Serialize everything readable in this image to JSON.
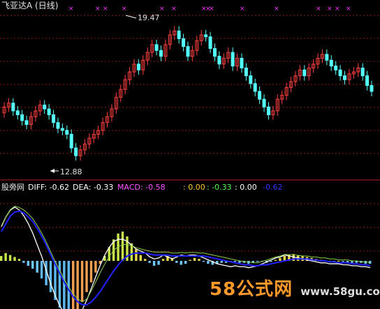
{
  "main_panel": {
    "title": "飞亚达A (日线)",
    "high_label": "19.47",
    "low_label": "12.88",
    "signal_marker": "×"
  },
  "indicator_panel": {
    "name": "股旁网",
    "diff": "DIFF: -0.62",
    "dea": "DEA: -0.33",
    "macd": "MACD: -0.58",
    "v1": ": 0.00",
    "v2": ": -0.33",
    "v3": ": 0.00",
    "v4": "-0.62"
  },
  "watermark": {
    "brand": "58公式网",
    "url": "www.58gu.com"
  },
  "colors": {
    "background": "#000000",
    "grid": "#8b1a1a",
    "up_candle": "#ff4040",
    "down_candle": "#54ffff",
    "diff_line": "#ffffff",
    "dea_line": "#2020ff",
    "macd_text": "#ff55ff",
    "signal": "#ff33ff"
  },
  "chart_data": {
    "type": "candlestick",
    "title": "飞亚达A (日线)",
    "high_marker": 19.47,
    "low_marker": 12.88,
    "ylim": [
      12.3,
      20.1
    ],
    "closes": [
      15.4,
      15.6,
      15.2,
      15.0,
      14.7,
      14.5,
      14.9,
      15.2,
      15.5,
      15.3,
      15.0,
      14.6,
      14.3,
      14.2,
      14.0,
      13.3,
      12.9,
      13.2,
      13.5,
      13.8,
      14.0,
      14.2,
      14.6,
      14.9,
      15.3,
      15.9,
      16.3,
      16.8,
      17.2,
      17.6,
      17.3,
      17.8,
      18.2,
      18.6,
      18.3,
      18.0,
      18.6,
      19.1,
      19.3,
      18.9,
      18.5,
      18.0,
      18.3,
      18.8,
      19.1,
      19.0,
      18.4,
      18.0,
      17.6,
      17.9,
      18.2,
      17.5,
      17.9,
      17.4,
      17.0,
      16.6,
      16.2,
      15.8,
      15.4,
      15.0,
      15.2,
      15.8,
      16.0,
      16.4,
      16.7,
      17.0,
      17.3,
      17.0,
      17.4,
      17.6,
      17.9,
      18.1,
      17.8,
      17.5,
      17.3,
      17.0,
      16.8,
      17.1,
      17.2,
      17.4,
      17.0,
      16.5,
      16.2
    ],
    "opens": [
      15.1,
      15.4,
      15.6,
      15.2,
      15.0,
      14.7,
      14.5,
      14.9,
      15.2,
      15.5,
      15.3,
      15.0,
      14.6,
      14.3,
      14.2,
      14.0,
      13.3,
      12.9,
      13.2,
      13.5,
      13.8,
      14.0,
      14.2,
      14.6,
      14.9,
      15.3,
      15.9,
      16.3,
      16.8,
      17.2,
      17.6,
      17.3,
      17.8,
      18.2,
      18.6,
      18.3,
      18.0,
      18.6,
      19.1,
      19.3,
      18.9,
      18.5,
      18.0,
      18.3,
      18.8,
      19.1,
      19.0,
      18.4,
      18.0,
      17.6,
      17.9,
      18.2,
      17.5,
      17.9,
      17.4,
      17.0,
      16.6,
      16.2,
      15.8,
      15.4,
      15.0,
      15.2,
      15.8,
      16.0,
      16.4,
      16.7,
      17.0,
      17.3,
      17.0,
      17.4,
      17.6,
      17.9,
      18.1,
      17.8,
      17.5,
      17.3,
      17.0,
      16.8,
      17.1,
      17.2,
      17.4,
      17.0,
      16.5
    ],
    "macd_bars": [
      0.05,
      0.08,
      0.06,
      0.04,
      0.02,
      -0.02,
      -0.05,
      -0.08,
      -0.12,
      -0.18,
      -0.25,
      -0.32,
      -0.4,
      -0.48,
      -0.55,
      -0.62,
      -0.58,
      -0.5,
      -0.42,
      -0.32,
      -0.22,
      -0.12,
      -0.03,
      0.05,
      0.14,
      0.22,
      0.28,
      0.3,
      0.25,
      0.18,
      0.12,
      0.06,
      0.02,
      -0.02,
      -0.05,
      -0.04,
      0.02,
      0.05,
      0.03,
      -0.02,
      -0.04,
      -0.03,
      0.01,
      0.03,
      0.02,
      -0.01,
      -0.03,
      -0.04,
      -0.03,
      -0.02,
      -0.02,
      -0.01,
      -0.01,
      -0.02,
      -0.02,
      -0.03,
      -0.02,
      -0.01,
      -0.01,
      -0.02,
      -0.01,
      0.01,
      0.03,
      0.05,
      0.06,
      0.07,
      0.06,
      0.05,
      0.04,
      0.03,
      0.02,
      0.01,
      0.0,
      -0.01,
      -0.01,
      0.0,
      -0.01,
      -0.02,
      -0.02,
      -0.02,
      -0.02,
      -0.03,
      -0.03
    ],
    "diff_line": [
      0.35,
      0.45,
      0.52,
      0.55,
      0.52,
      0.46,
      0.38,
      0.28,
      0.16,
      0.04,
      -0.1,
      -0.24,
      -0.36,
      -0.46,
      -0.54,
      -0.6,
      -0.62,
      -0.58,
      -0.5,
      -0.4,
      -0.28,
      -0.16,
      -0.04,
      0.06,
      0.14,
      0.2,
      0.22,
      0.22,
      0.2,
      0.16,
      0.12,
      0.1,
      0.08,
      0.04,
      0.02,
      0.03,
      0.06,
      0.04,
      0.02,
      0.04,
      0.06,
      0.05,
      0.06,
      0.06,
      0.05,
      0.03,
      0.01,
      -0.01,
      -0.03,
      -0.04,
      -0.05,
      -0.06,
      -0.05,
      -0.06,
      -0.06,
      -0.07,
      -0.06,
      -0.05,
      -0.03,
      -0.01,
      0.01,
      0.03,
      0.04,
      0.06,
      0.05,
      0.04,
      0.03,
      0.02,
      0.01,
      0.0,
      -0.01,
      -0.02,
      -0.02,
      -0.03,
      -0.03,
      -0.03,
      -0.04,
      -0.04,
      -0.05,
      -0.05,
      -0.06,
      -0.06,
      -0.07
    ],
    "dea_line": [
      0.3,
      0.38,
      0.46,
      0.5,
      0.51,
      0.49,
      0.45,
      0.4,
      0.33,
      0.25,
      0.16,
      0.06,
      -0.04,
      -0.13,
      -0.22,
      -0.3,
      -0.37,
      -0.42,
      -0.45,
      -0.45,
      -0.42,
      -0.37,
      -0.31,
      -0.24,
      -0.17,
      -0.1,
      -0.04,
      0.01,
      0.05,
      0.07,
      0.08,
      0.08,
      0.08,
      0.07,
      0.06,
      0.06,
      0.06,
      0.06,
      0.05,
      0.05,
      0.05,
      0.05,
      0.05,
      0.05,
      0.05,
      0.05,
      0.04,
      0.03,
      0.02,
      0.01,
      0.0,
      -0.01,
      -0.02,
      -0.03,
      -0.04,
      -0.04,
      -0.05,
      -0.05,
      -0.04,
      -0.04,
      -0.03,
      -0.02,
      -0.01,
      0.0,
      0.01,
      0.02,
      0.02,
      0.02,
      0.02,
      0.01,
      0.01,
      0.0,
      0.0,
      -0.01,
      -0.01,
      -0.02,
      -0.02,
      -0.02,
      -0.03,
      -0.03,
      -0.04,
      -0.04,
      -0.05
    ],
    "signal_positions": [
      0.18,
      0.25,
      0.27,
      0.32,
      0.42,
      0.45,
      0.53,
      0.54,
      0.55,
      0.63,
      0.72,
      0.83,
      0.86,
      0.88,
      0.91
    ]
  }
}
